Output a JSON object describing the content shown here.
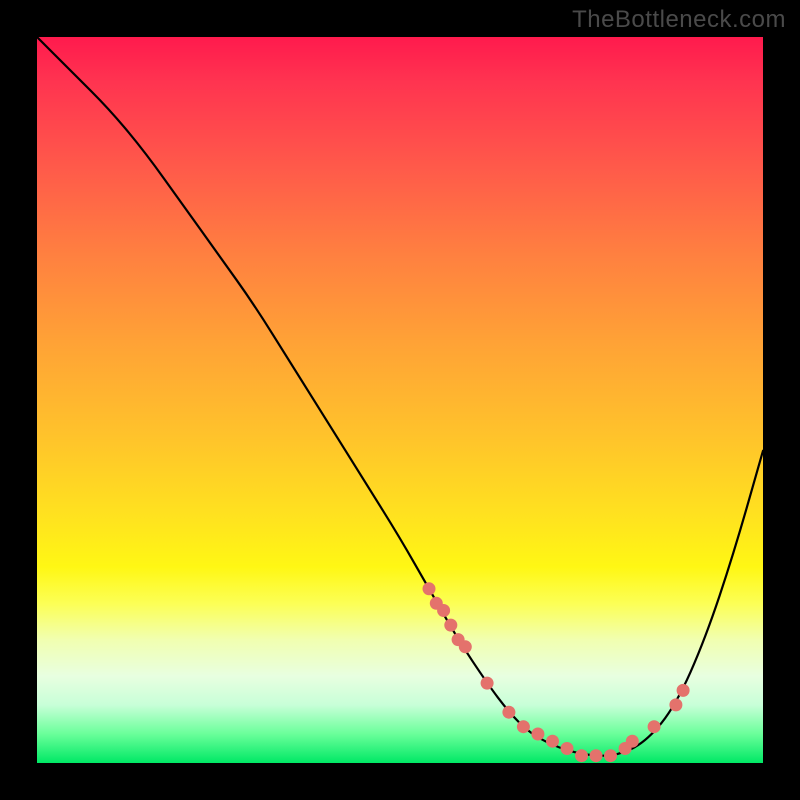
{
  "attribution": "TheBottleneck.com",
  "chart_data": {
    "type": "line",
    "title": "",
    "xlabel": "",
    "ylabel": "",
    "xlim": [
      0,
      100
    ],
    "ylim": [
      0,
      100
    ],
    "series": [
      {
        "name": "bottleneck-curve",
        "x": [
          0,
          5,
          10,
          15,
          20,
          25,
          30,
          35,
          40,
          45,
          50,
          54,
          58,
          62,
          65,
          68,
          72,
          76,
          80,
          84,
          88,
          92,
          96,
          100
        ],
        "values": [
          100,
          95,
          90,
          84,
          77,
          70,
          63,
          55,
          47,
          39,
          31,
          24,
          17,
          11,
          7,
          4,
          2,
          1,
          1,
          3,
          8,
          17,
          29,
          43
        ]
      }
    ],
    "markers": {
      "name": "highlighted-points",
      "x": [
        54,
        55,
        56,
        57,
        58,
        59,
        62,
        65,
        67,
        69,
        71,
        73,
        75,
        77,
        79,
        81,
        82,
        85,
        88,
        89
      ],
      "values": [
        24,
        22,
        21,
        19,
        17,
        16,
        11,
        7,
        5,
        4,
        3,
        2,
        1,
        1,
        1,
        2,
        3,
        5,
        8,
        10
      ]
    },
    "gradient_stops": [
      {
        "pct": 0,
        "color": "#ff1a4d"
      },
      {
        "pct": 50,
        "color": "#ffc32b"
      },
      {
        "pct": 80,
        "color": "#fcff55"
      },
      {
        "pct": 100,
        "color": "#00e865"
      }
    ]
  }
}
